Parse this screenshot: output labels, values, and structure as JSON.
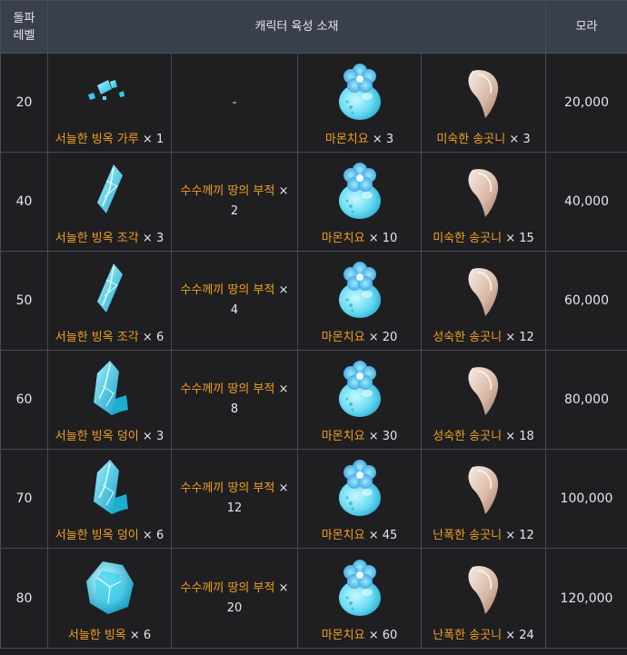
{
  "header": {
    "level_line1": "돌파",
    "level_line2": "레벨",
    "materials": "캐릭터 육성 소재",
    "mora": "모라"
  },
  "colors": {
    "material_name": "#f0a020",
    "header_bg": "#3a3f4c",
    "row_bg": "#1f1f22",
    "border": "#4a4b52"
  },
  "rows": [
    {
      "level": "20",
      "gem": {
        "name": "서늘한 빙옥 가루",
        "qty": " × 1",
        "icon": "ice-gem-sliver-icon"
      },
      "talisman": {
        "dash": "-"
      },
      "specialty": {
        "name": "마몬치요",
        "qty": " × 3",
        "icon": "mamonchiyo-icon"
      },
      "common": {
        "name": "미숙한 송곳니",
        "qty": " × 3",
        "icon": "fang-icon"
      },
      "mora": "20,000"
    },
    {
      "level": "40",
      "gem": {
        "name": "서늘한 빙옥 조각",
        "qty": " × 3",
        "icon": "ice-gem-fragment-icon"
      },
      "talisman": {
        "name": "수수께끼 땅의 부적",
        "x": " ×",
        "count": "2"
      },
      "specialty": {
        "name": "마몬치요",
        "qty": " × 10",
        "icon": "mamonchiyo-icon"
      },
      "common": {
        "name": "미숙한 송곳니",
        "qty": " × 15",
        "icon": "fang-icon"
      },
      "mora": "40,000"
    },
    {
      "level": "50",
      "gem": {
        "name": "서늘한 빙옥 조각",
        "qty": " × 6",
        "icon": "ice-gem-fragment-icon"
      },
      "talisman": {
        "name": "수수께끼 땅의 부적",
        "x": " ×",
        "count": "4"
      },
      "specialty": {
        "name": "마몬치요",
        "qty": " × 20",
        "icon": "mamonchiyo-icon"
      },
      "common": {
        "name": "성숙한 송곳니",
        "qty": " × 12",
        "icon": "fang-icon"
      },
      "mora": "60,000"
    },
    {
      "level": "60",
      "gem": {
        "name": "서늘한 빙옥 덩이",
        "qty": " × 3",
        "icon": "ice-gem-chunk-icon"
      },
      "talisman": {
        "name": "수수께끼 땅의 부적",
        "x": " ×",
        "count": "8"
      },
      "specialty": {
        "name": "마몬치요",
        "qty": " × 30",
        "icon": "mamonchiyo-icon"
      },
      "common": {
        "name": "성숙한 송곳니",
        "qty": " × 18",
        "icon": "fang-icon"
      },
      "mora": "80,000"
    },
    {
      "level": "70",
      "gem": {
        "name": "서늘한 빙옥 덩이",
        "qty": " × 6",
        "icon": "ice-gem-chunk-icon"
      },
      "talisman": {
        "name": "수수께끼 땅의 부적",
        "x": " ×",
        "count": "12"
      },
      "specialty": {
        "name": "마몬치요",
        "qty": " × 45",
        "icon": "mamonchiyo-icon"
      },
      "common": {
        "name": "난폭한 송곳니",
        "qty": " × 12",
        "icon": "fang-icon"
      },
      "mora": "100,000"
    },
    {
      "level": "80",
      "gem": {
        "name": "서늘한 빙옥",
        "qty": " × 6",
        "icon": "ice-gem-icon"
      },
      "talisman": {
        "name": "수수께끼 땅의 부적",
        "x": " ×",
        "count": "20"
      },
      "specialty": {
        "name": "마몬치요",
        "qty": " × 60",
        "icon": "mamonchiyo-icon"
      },
      "common": {
        "name": "난폭한 송곳니",
        "qty": " × 24",
        "icon": "fang-icon"
      },
      "mora": "120,000"
    }
  ]
}
